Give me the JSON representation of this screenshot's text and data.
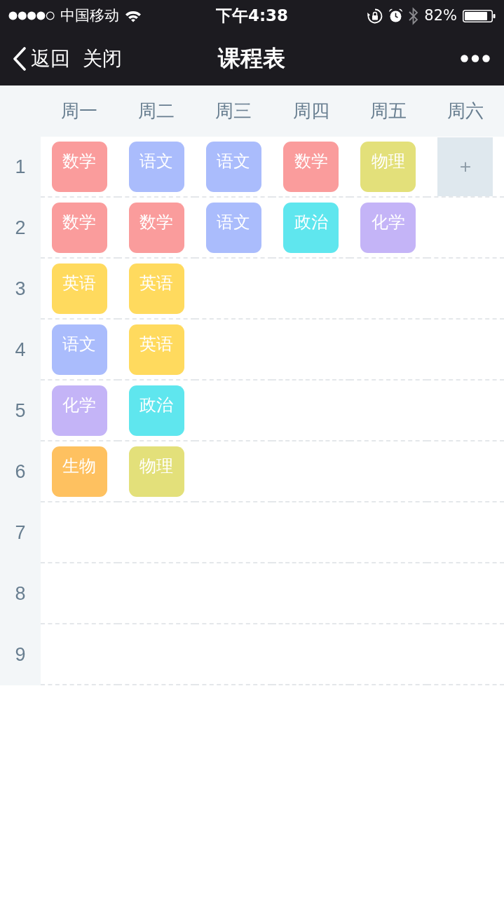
{
  "status_bar": {
    "carrier": "中国移动",
    "time": "下午4:38",
    "battery": "82%"
  },
  "nav_bar": {
    "back": "返回",
    "close": "关闭",
    "title": "课程表"
  },
  "timetable": {
    "days": [
      "周一",
      "周二",
      "周三",
      "周四",
      "周五",
      "周六"
    ],
    "periods": [
      {
        "number": "1",
        "cells": [
          {
            "kind": "course",
            "name": "数学",
            "color": "#fa9c9c"
          },
          {
            "kind": "course",
            "name": "语文",
            "color": "#aabcfc"
          },
          {
            "kind": "course",
            "name": "语文",
            "color": "#aabcfc"
          },
          {
            "kind": "course",
            "name": "数学",
            "color": "#fa9c9c"
          },
          {
            "kind": "course",
            "name": "物理",
            "color": "#e3e07a"
          },
          {
            "kind": "add",
            "label": "+"
          }
        ]
      },
      {
        "number": "2",
        "cells": [
          {
            "kind": "course",
            "name": "数学",
            "color": "#fa9c9c"
          },
          {
            "kind": "course",
            "name": "数学",
            "color": "#fa9c9c"
          },
          {
            "kind": "course",
            "name": "语文",
            "color": "#aabcfc"
          },
          {
            "kind": "course",
            "name": "政治",
            "color": "#5fe6ee"
          },
          {
            "kind": "course",
            "name": "化学",
            "color": "#c4b4f7"
          }
        ]
      },
      {
        "number": "3",
        "cells": [
          {
            "kind": "course",
            "name": "英语",
            "color": "#ffda5e"
          },
          {
            "kind": "course",
            "name": "英语",
            "color": "#ffda5e"
          }
        ]
      },
      {
        "number": "4",
        "cells": [
          {
            "kind": "course",
            "name": "语文",
            "color": "#aabcfc"
          },
          {
            "kind": "course",
            "name": "英语",
            "color": "#ffda5e"
          }
        ]
      },
      {
        "number": "5",
        "cells": [
          {
            "kind": "course",
            "name": "化学",
            "color": "#c4b4f7"
          },
          {
            "kind": "course",
            "name": "政治",
            "color": "#5fe6ee"
          }
        ]
      },
      {
        "number": "6",
        "cells": [
          {
            "kind": "course",
            "name": "生物",
            "color": "#fec160"
          },
          {
            "kind": "course",
            "name": "物理",
            "color": "#e3e07a"
          }
        ]
      },
      {
        "number": "7"
      },
      {
        "number": "8"
      },
      {
        "number": "9"
      }
    ]
  }
}
